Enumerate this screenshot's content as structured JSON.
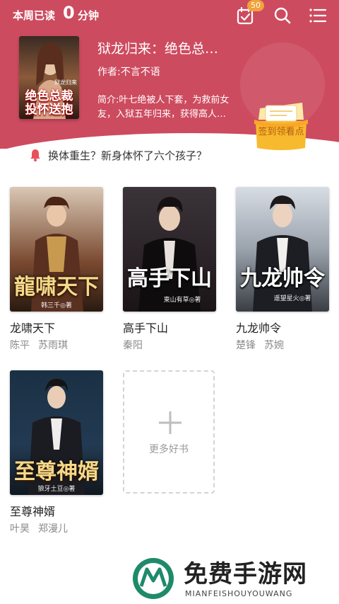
{
  "header": {
    "read_label": "本周已读",
    "read_count": "0",
    "read_unit": "分钟",
    "checkin_badge": "50",
    "bg_color": "#cd4b5f"
  },
  "featured": {
    "cover_line1": "狱龙归来",
    "cover_line2": "绝色总裁",
    "cover_line3": "投怀送抱",
    "title": "狱龙归来：绝色总…",
    "author": "作者:不言不语",
    "intro": "简介:叶七绝被人下套，为救前女友，入狱五年归来，获得高人…"
  },
  "signin": {
    "label": "签到领看点"
  },
  "notice": {
    "text": "换体重生？新身体怀了六个孩子？"
  },
  "books": [
    {
      "title": "龙啸天下",
      "cover_text": "龍啸天下",
      "cover_author": "韩三千◎著",
      "characters": [
        "陈平",
        "苏雨琪"
      ]
    },
    {
      "title": "高手下山",
      "cover_text": "高手下山",
      "cover_author": "東山有草◎著",
      "characters": [
        "秦阳"
      ]
    },
    {
      "title": "九龙帅令",
      "cover_text": "九龙帅令",
      "cover_author": "遥望星火◎著",
      "characters": [
        "楚锋",
        "苏婉"
      ]
    },
    {
      "title": "至尊神婿",
      "cover_text": "至尊神婿",
      "cover_author": "狼牙土豆◎著",
      "characters": [
        "叶昊",
        "郑漫儿"
      ]
    }
  ],
  "more": {
    "label": "更多好书"
  },
  "watermark": {
    "main": "免费手游网",
    "sub": "MIANFEISHOUYOUWANG"
  }
}
